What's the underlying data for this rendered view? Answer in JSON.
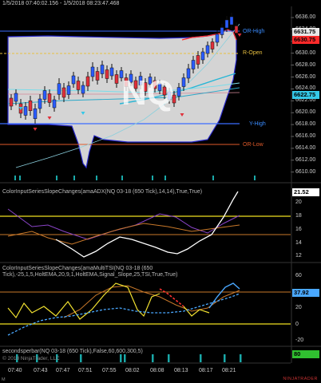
{
  "header": {
    "range": "1/5/2018 07:40:02.156 - 1/5/2018 08:23:47.468"
  },
  "watermark": "NQ",
  "price_axis": [
    "6636.00",
    "6634.00",
    "6632.00",
    "6630.00",
    "6628.00",
    "6626.00",
    "6624.00",
    "6622.00",
    "6620.00",
    "6618.00",
    "6616.00",
    "6614.00",
    "6612.00",
    "6610.00"
  ],
  "price_tags": [
    {
      "value": "6631.75",
      "bg": "#e8e8e8",
      "fg": "#000"
    },
    {
      "value": "6630.75",
      "bg": "#ff2a2a",
      "fg": "#000"
    },
    {
      "value": "6622.75",
      "bg": "#35c8e8",
      "fg": "#000"
    }
  ],
  "level_labels": [
    {
      "text": "OR-High",
      "color": "#3a8cff"
    },
    {
      "text": "R-Open",
      "color": "#e8c040"
    },
    {
      "text": "Y-High",
      "color": "#3a8cff"
    },
    {
      "text": "OR-Low",
      "color": "#e05a2a"
    }
  ],
  "panes": {
    "adx": {
      "title": "ColorInputSeriesSlopeChanges(amaADX(NQ 03-18 (650 Tick),14,14),True,True)",
      "axis": [
        "20",
        "18",
        "16",
        "14",
        "12"
      ],
      "value_tag": "21.52"
    },
    "tsi": {
      "title_line1": "ColorInputSeriesSlopeChanges(amaMultiTSI(NQ 03-18 (650",
      "title_line2": "Tick),-25,1,5,HoltEMA,20,9,1,HoltEMA,Signal_Slope,25,TSI,True,True)",
      "axis": [
        "60",
        "40",
        "20",
        "0",
        "-20"
      ],
      "value_tag": "37.92"
    },
    "seconds": {
      "title": "secondsperbar(NQ 03-18 (650 Tick),False,60,600,300,5)",
      "axis": [
        "80"
      ],
      "value_tag": "80"
    }
  },
  "time_axis": [
    "07:40",
    "07:43",
    "07:47",
    "07:51",
    "07:55",
    "08:02",
    "08:08",
    "08:13",
    "08:17",
    "08:21"
  ],
  "copyright": "© 2018 NinjaTrader, LLC",
  "brand": "NINJATRADER",
  "colors": {
    "up": "#2a5cff",
    "down": "#e0303a",
    "bg": "#000000",
    "band": "#d7d7d7"
  }
}
